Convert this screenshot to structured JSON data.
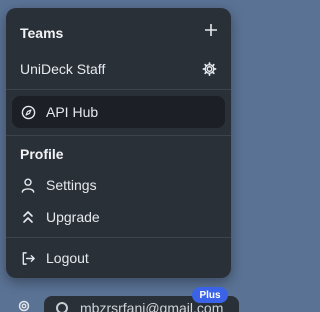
{
  "menu": {
    "teams_title": "Teams",
    "team_name": "UniDeck Staff",
    "api_hub_label": "API Hub",
    "profile_title": "Profile",
    "settings_label": "Settings",
    "upgrade_label": "Upgrade",
    "logout_label": "Logout"
  },
  "bottom": {
    "badge": "Plus",
    "email": "mbzrsrfani@gmail.com"
  },
  "icons": {
    "add": "plus-icon",
    "team_settings": "gear-icon",
    "api_hub": "compass-icon",
    "settings": "user-icon",
    "upgrade": "chevrons-up-icon",
    "logout": "logout-icon"
  },
  "colors": {
    "background": "#5a7294",
    "menu": "#2a3038",
    "active_item": "#1c2026",
    "badge": "#3b63e8"
  }
}
